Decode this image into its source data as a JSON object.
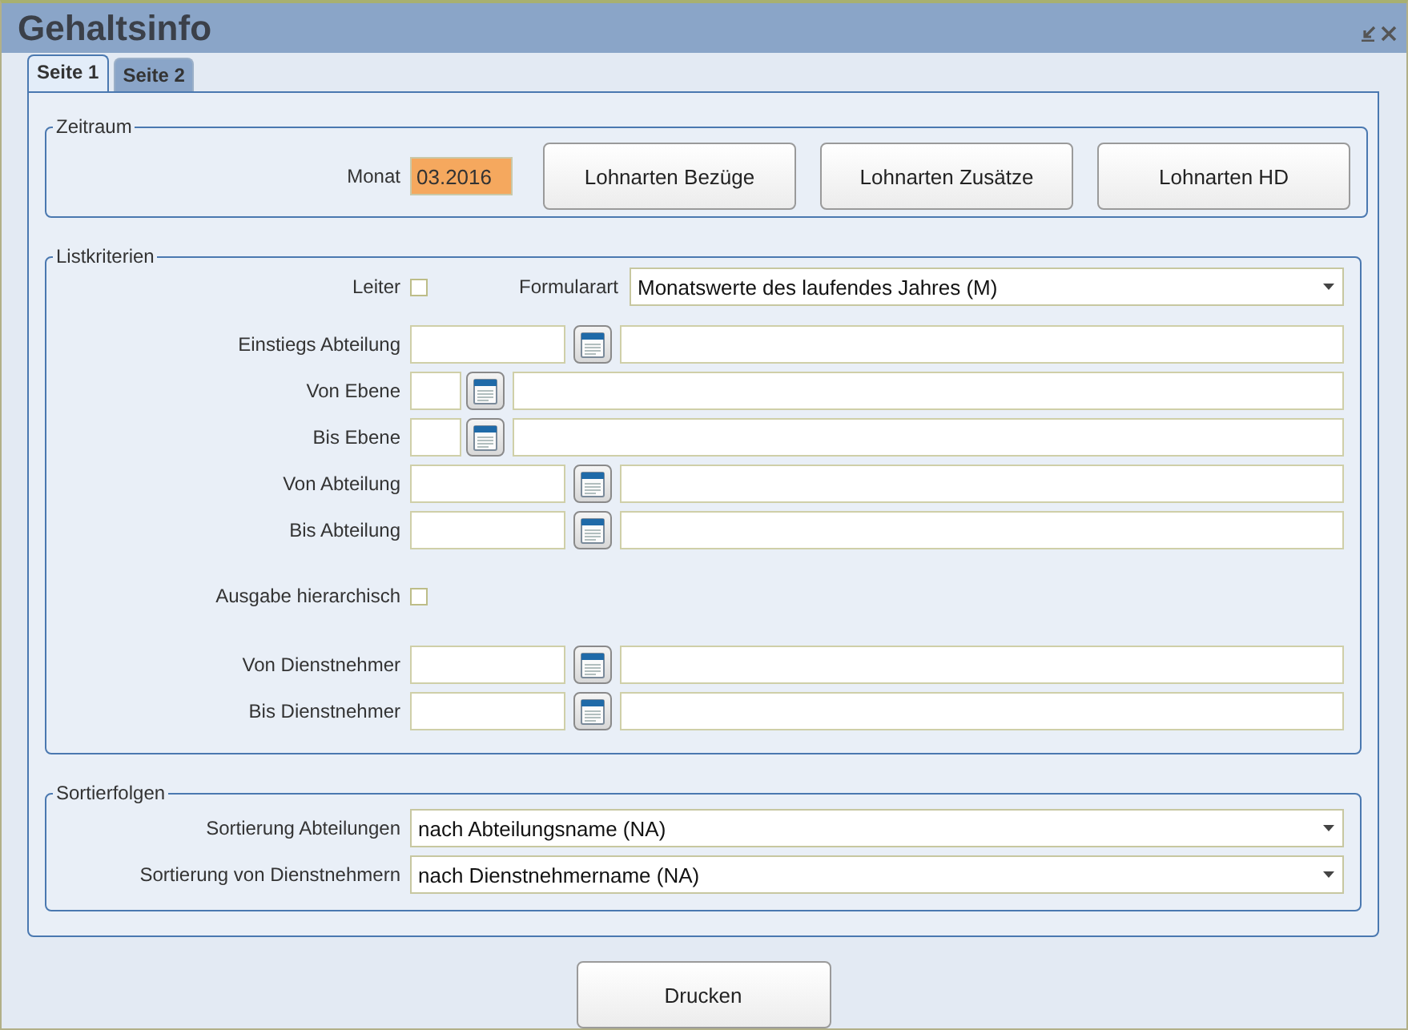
{
  "window": {
    "title": "Gehaltsinfo"
  },
  "tabs": [
    {
      "label": "Seite 1",
      "selected": true
    },
    {
      "label": "Seite 2",
      "selected": false
    }
  ],
  "zeitraum": {
    "legend": "Zeitraum",
    "month_label": "Monat",
    "month_value": "03.2016",
    "buttons": [
      "Lohnarten Bezüge",
      "Lohnarten Zusätze",
      "Lohnarten HD"
    ]
  },
  "listkriterien": {
    "legend": "Listkriterien",
    "leiter": {
      "label": "Leiter",
      "checked": false
    },
    "formularart": {
      "label": "Formularart",
      "value": "Monatswerte des laufendes Jahres (M)"
    },
    "rows": [
      {
        "kind": "lookup",
        "label": "Einstiegs Abteilung"
      },
      {
        "kind": "short_lookup",
        "label": "Von Ebene"
      },
      {
        "kind": "short_lookup",
        "label": "Bis Ebene"
      },
      {
        "kind": "lookup",
        "label": "Von Abteilung"
      },
      {
        "kind": "lookup",
        "label": "Bis Abteilung"
      },
      {
        "kind": "checkbox",
        "label": "Ausgabe hierarchisch",
        "checked": false
      },
      {
        "kind": "lookup",
        "label": "Von Dienstnehmer"
      },
      {
        "kind": "lookup",
        "label": "Bis Dienstnehmer"
      }
    ]
  },
  "sortierfolgen": {
    "legend": "Sortierfolgen",
    "rows": [
      {
        "label": "Sortierung Abteilungen",
        "value": "nach Abteilungsname (NA)"
      },
      {
        "label": "Sortierung von Dienstnehmern",
        "value": "nach Dienstnehmername (NA)"
      }
    ]
  },
  "print_button": "Drucken"
}
